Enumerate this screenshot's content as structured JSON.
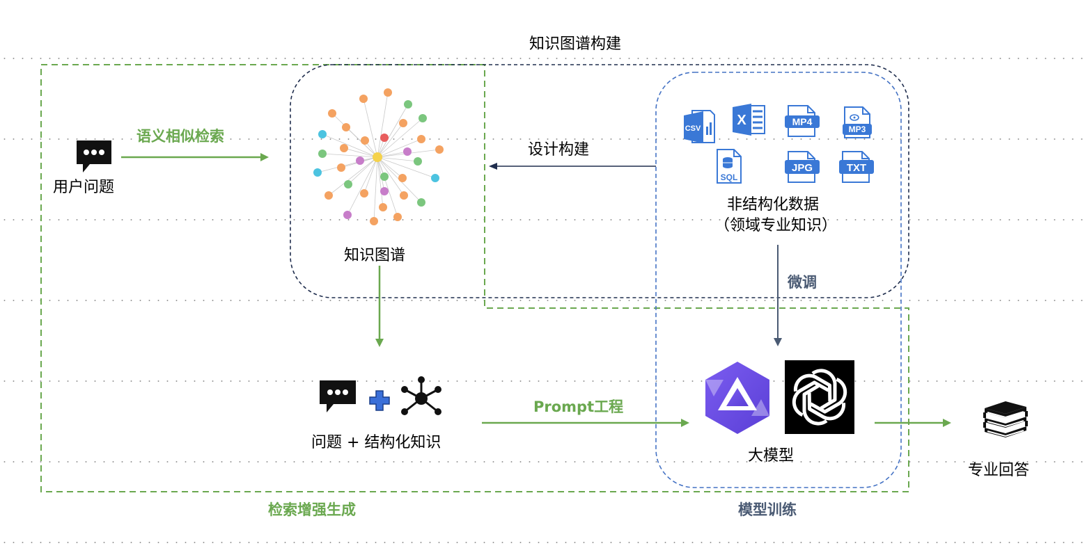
{
  "title": "知识图谱构建",
  "user_question": "用户问题",
  "semantic_search": "语义相似检索",
  "knowledge_graph": "知识图谱",
  "design_build": "设计构建",
  "unstructured_data_line1": "非结构化数据",
  "unstructured_data_line2": "（领域专业知识）",
  "fine_tune": "微调",
  "question_plus_knowledge": "问题 + 结构化知识",
  "prompt_engineering": "Prompt工程",
  "llm": "大模型",
  "professional_answer": "专业回答",
  "rag": "检索增强生成",
  "model_training": "模型训练",
  "file_icons": {
    "csv": "CSV",
    "xls": "X",
    "mp4": "MP4",
    "mp3": "MP3",
    "sql": "SQL",
    "jpg": "JPG",
    "txt": "TXT"
  },
  "colors": {
    "green": "#6aa84f",
    "navy": "#1f2d4d",
    "blue": "#4472c4",
    "slate": "#4a5a73",
    "file_blue": "#3a78d6",
    "qwen_purple": "#6b4ce6"
  }
}
